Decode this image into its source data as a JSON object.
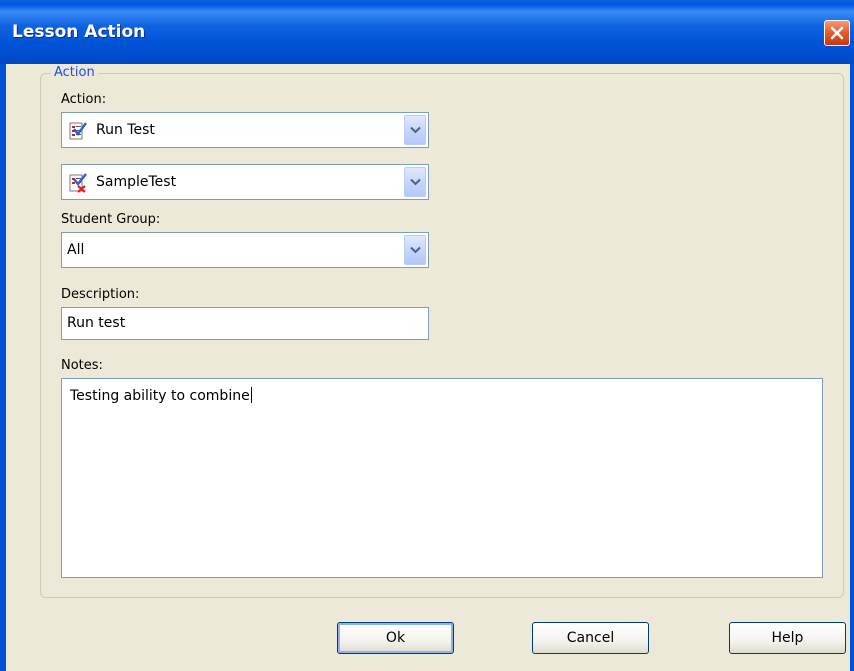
{
  "window": {
    "title": "Lesson Action",
    "close_icon": "close-icon"
  },
  "group": {
    "legend": "Action"
  },
  "action": {
    "label": "Action:",
    "selected": "Run Test",
    "icon": "test-checklist-icon"
  },
  "test": {
    "selected": "SampleTest",
    "icon": "test-checklist-x-icon"
  },
  "student_group": {
    "label": "Student Group:",
    "selected": "All"
  },
  "description": {
    "label": "Description:",
    "value": "Run test"
  },
  "notes": {
    "label": "Notes:",
    "value": "Testing ability to combine"
  },
  "buttons": {
    "ok": "Ok",
    "cancel": "Cancel",
    "help": "Help"
  },
  "colors": {
    "titlebar": "#0052d6",
    "dialog_bg": "#ece9d8",
    "legend_text": "#1f4fd0",
    "field_border": "#7f9db9",
    "close_button": "#e45a2c"
  }
}
